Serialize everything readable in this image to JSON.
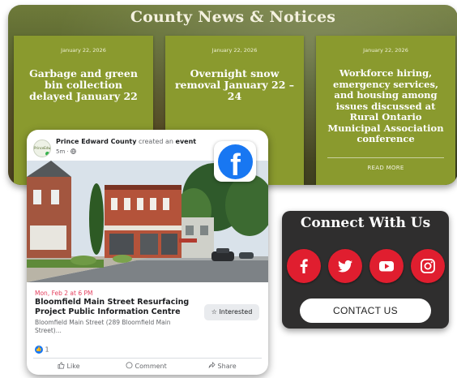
{
  "news": {
    "title": "County News & Notices",
    "cards": [
      {
        "date": "January 22, 2026",
        "headline": "Garbage and green bin collection delayed January 22",
        "link": ""
      },
      {
        "date": "January 22, 2026",
        "headline": "Overnight snow removal January 22 – 24",
        "link": ""
      },
      {
        "date": "January 22, 2026",
        "headline": "Workforce hiring, emergency services, and housing among issues discussed at Rural Ontario Municipal Association conference",
        "link": "READ MORE"
      }
    ]
  },
  "facebook_post": {
    "poster": "Prince Edward County",
    "action": " created an ",
    "action_object": "event",
    "meta": "5m · ",
    "avatar_text": "PrinceEdward",
    "event_when": "Mon, Feb 2 at 6 PM",
    "event_title": "Bloomfield Main Street Resurfacing Project Public Information Centre",
    "event_location": "Bloomfield Main Street (289 Bloomfield Main Street)...",
    "interested_label": "Interested",
    "reaction_count": "1",
    "actions": {
      "like": "Like",
      "comment": "Comment",
      "share": "Share"
    }
  },
  "connect": {
    "title": "Connect With Us",
    "networks": [
      "facebook-icon",
      "twitter-icon",
      "youtube-icon",
      "instagram-icon"
    ],
    "contact_label": "CONTACT US"
  },
  "colors": {
    "card_green": "#8a9a2e",
    "social_red": "#e01e2f",
    "facebook_blue": "#1877f2",
    "connect_dark": "#2f2e2e"
  }
}
